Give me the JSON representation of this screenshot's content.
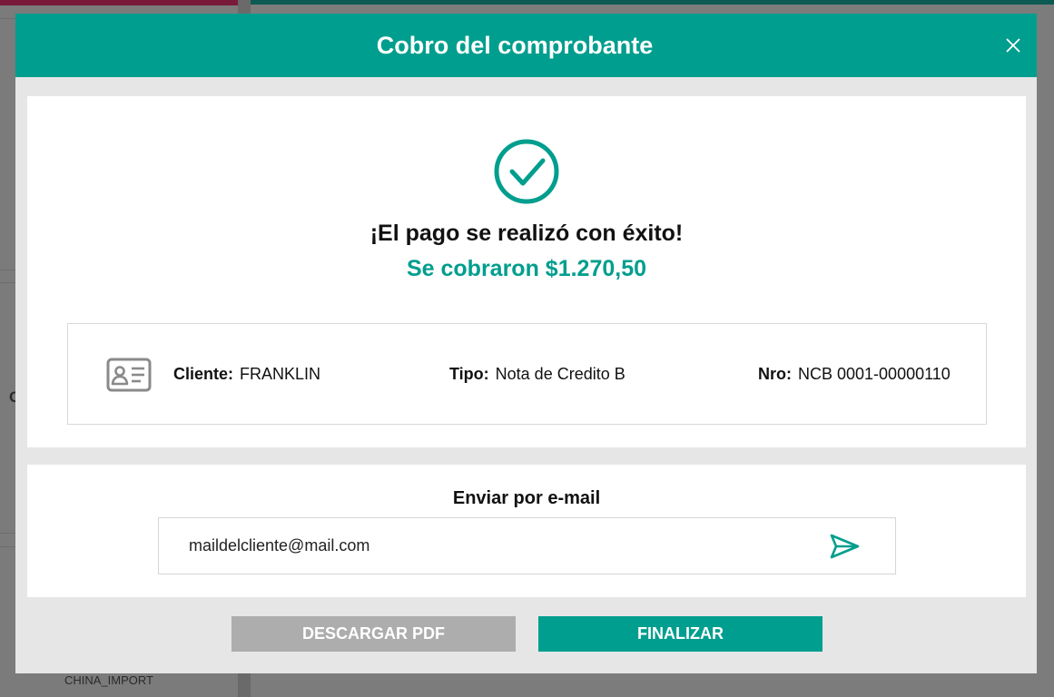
{
  "background": {
    "sidebar_item": "CHINA_IMPORT",
    "sidebar_partial_char": "C"
  },
  "modal": {
    "title": "Cobro del comprobante",
    "success": {
      "title": "¡El pago se realizó con éxito!",
      "charged": "Se cobraron $1.270,50"
    },
    "info": {
      "client_label": "Cliente:",
      "client_value": "FRANKLIN",
      "type_label": "Tipo:",
      "type_value": "Nota de Credito B",
      "number_label": "Nro:",
      "number_value": "NCB 0001-00000110"
    },
    "email": {
      "title": "Enviar por e-mail",
      "value": "maildelcliente@mail.com"
    },
    "buttons": {
      "download_pdf": "DESCARGAR PDF",
      "finish": "FINALIZAR"
    }
  },
  "colors": {
    "accent": "#009e8e",
    "secondary_button": "#adadad",
    "icon_gray": "#8a8a8a"
  },
  "icons": {
    "close": "close-icon",
    "success": "check-circle-icon",
    "card": "id-card-icon",
    "send": "send-icon"
  }
}
